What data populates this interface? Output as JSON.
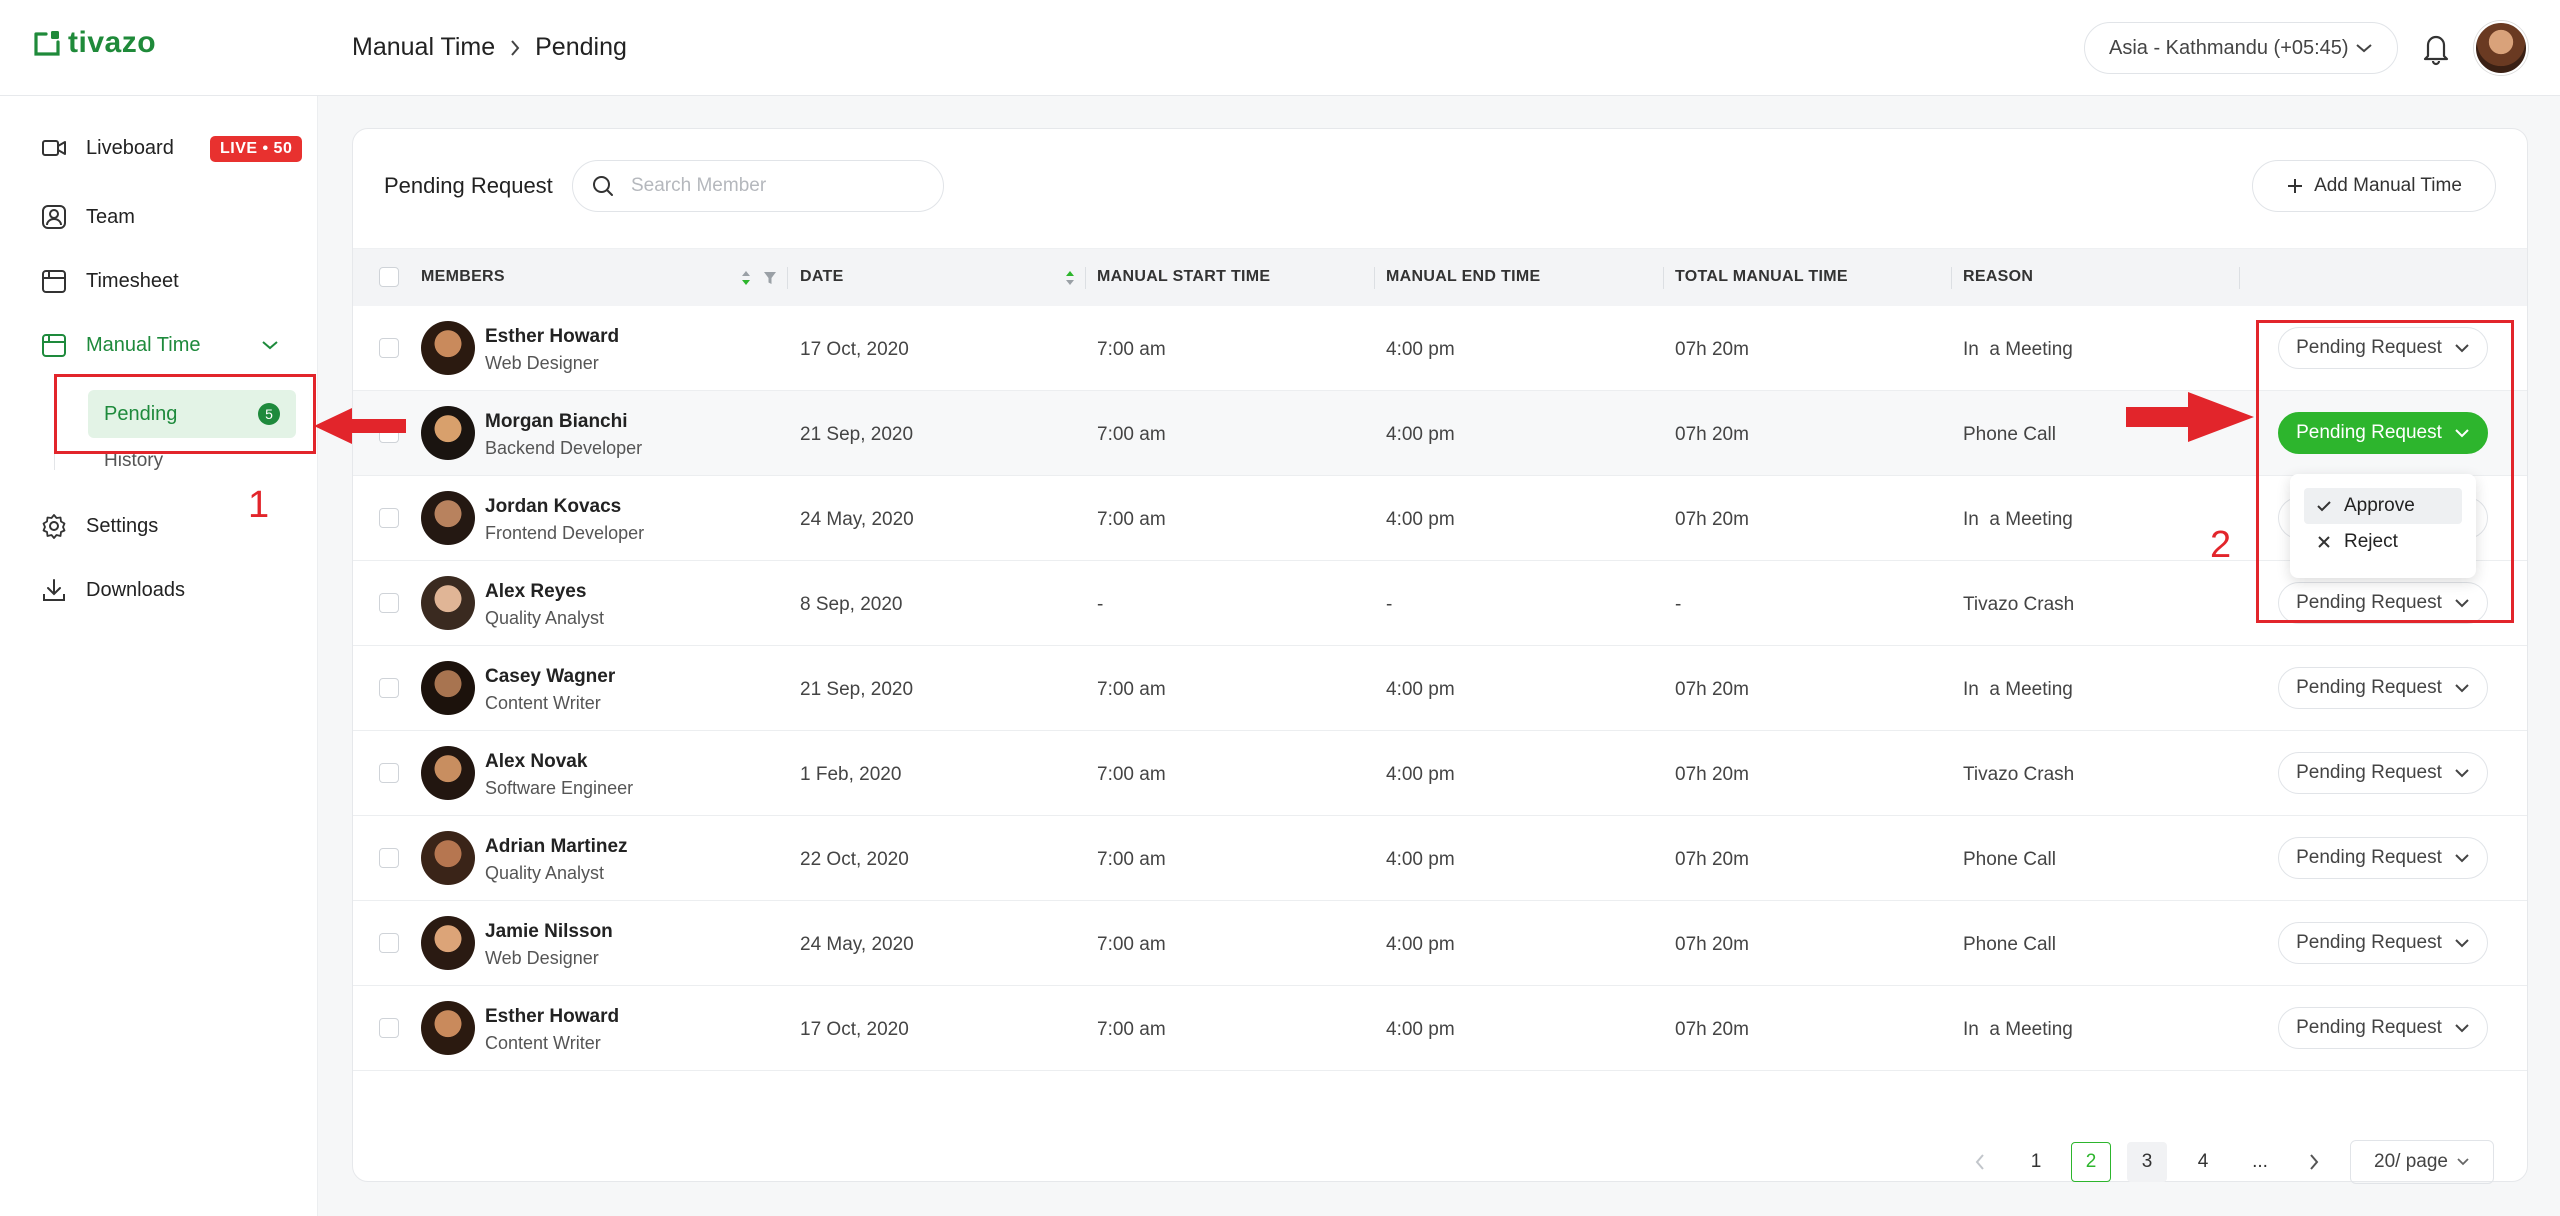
{
  "brand": {
    "name": "tivazo",
    "color": "#1f8a3a"
  },
  "header": {
    "breadcrumb": [
      "Manual Time",
      "Pending"
    ],
    "timezone": "Asia - Kathmandu (+05:45)"
  },
  "sidebar": {
    "items": [
      {
        "label": "Liveboard",
        "icon": "liveboard-icon",
        "badge": "LIVE • 50"
      },
      {
        "label": "Team",
        "icon": "team-icon"
      },
      {
        "label": "Timesheet",
        "icon": "timesheet-icon"
      },
      {
        "label": "Manual Time",
        "icon": "manual-time-icon",
        "expanded": true
      },
      {
        "label": "Settings",
        "icon": "gear-icon"
      },
      {
        "label": "Downloads",
        "icon": "download-icon"
      }
    ],
    "manual_time_sub": [
      {
        "label": "Pending",
        "count": "5",
        "active": true
      },
      {
        "label": "History"
      }
    ]
  },
  "toolbar": {
    "title": "Pending Request",
    "search_placeholder": "Search Member",
    "add_label": "Add Manual Time"
  },
  "table": {
    "columns": [
      "MEMBERS",
      "DATE",
      "MANUAL START TIME",
      "MANUAL END TIME",
      "TOTAL MANUAL TIME",
      "REASON"
    ],
    "rows": [
      {
        "name": "Esther Howard",
        "role": "Web Designer",
        "date": "17 Oct, 2020",
        "start": "7:00 am",
        "end": "4:00 pm",
        "total": "07h 20m",
        "reason": "In  a Meeting",
        "status": "Pending Request"
      },
      {
        "name": "Morgan Bianchi",
        "role": "Backend Developer",
        "date": "21 Sep, 2020",
        "start": "7:00 am",
        "end": "4:00 pm",
        "total": "07h 20m",
        "reason": "Phone Call",
        "status": "Pending Request"
      },
      {
        "name": "Jordan Kovacs",
        "role": "Frontend Developer",
        "date": "24 May, 2020",
        "start": "7:00 am",
        "end": "4:00 pm",
        "total": "07h 20m",
        "reason": "In  a Meeting",
        "status": "Pending Request"
      },
      {
        "name": "Alex Reyes",
        "role": "Quality Analyst",
        "date": "8 Sep, 2020",
        "start": "-",
        "end": "-",
        "total": "-",
        "reason": "Tivazo Crash",
        "status": "Pending Request"
      },
      {
        "name": "Casey Wagner",
        "role": "Content Writer",
        "date": "21 Sep, 2020",
        "start": "7:00 am",
        "end": "4:00 pm",
        "total": "07h 20m",
        "reason": "In  a Meeting",
        "status": "Pending Request"
      },
      {
        "name": "Alex Novak",
        "role": "Software Engineer",
        "date": "1 Feb, 2020",
        "start": "7:00 am",
        "end": "4:00 pm",
        "total": "07h 20m",
        "reason": "Tivazo Crash",
        "status": "Pending Request"
      },
      {
        "name": "Adrian Martinez",
        "role": "Quality Analyst",
        "date": "22 Oct, 2020",
        "start": "7:00 am",
        "end": "4:00 pm",
        "total": "07h 20m",
        "reason": "Phone Call",
        "status": "Pending Request"
      },
      {
        "name": "Jamie Nilsson",
        "role": "Web Designer",
        "date": "24 May, 2020",
        "start": "7:00 am",
        "end": "4:00 pm",
        "total": "07h 20m",
        "reason": "Phone Call",
        "status": "Pending Request"
      },
      {
        "name": "Esther Howard",
        "role": "Content Writer",
        "date": "17 Oct, 2020",
        "start": "7:00 am",
        "end": "4:00 pm",
        "total": "07h 20m",
        "reason": "In  a Meeting",
        "status": "Pending Request"
      }
    ]
  },
  "dropdown": {
    "options": [
      "Approve",
      "Reject"
    ],
    "selected": "Approve"
  },
  "pagination": {
    "pages": [
      "1",
      "2",
      "3",
      "4",
      "..."
    ],
    "current": "2",
    "per_page": "20/ page"
  },
  "annotations": {
    "label_1": "1",
    "label_2": "2",
    "color": "#e2252b"
  },
  "colors": {
    "accent": "#2db52d",
    "live": "#e8312f"
  }
}
